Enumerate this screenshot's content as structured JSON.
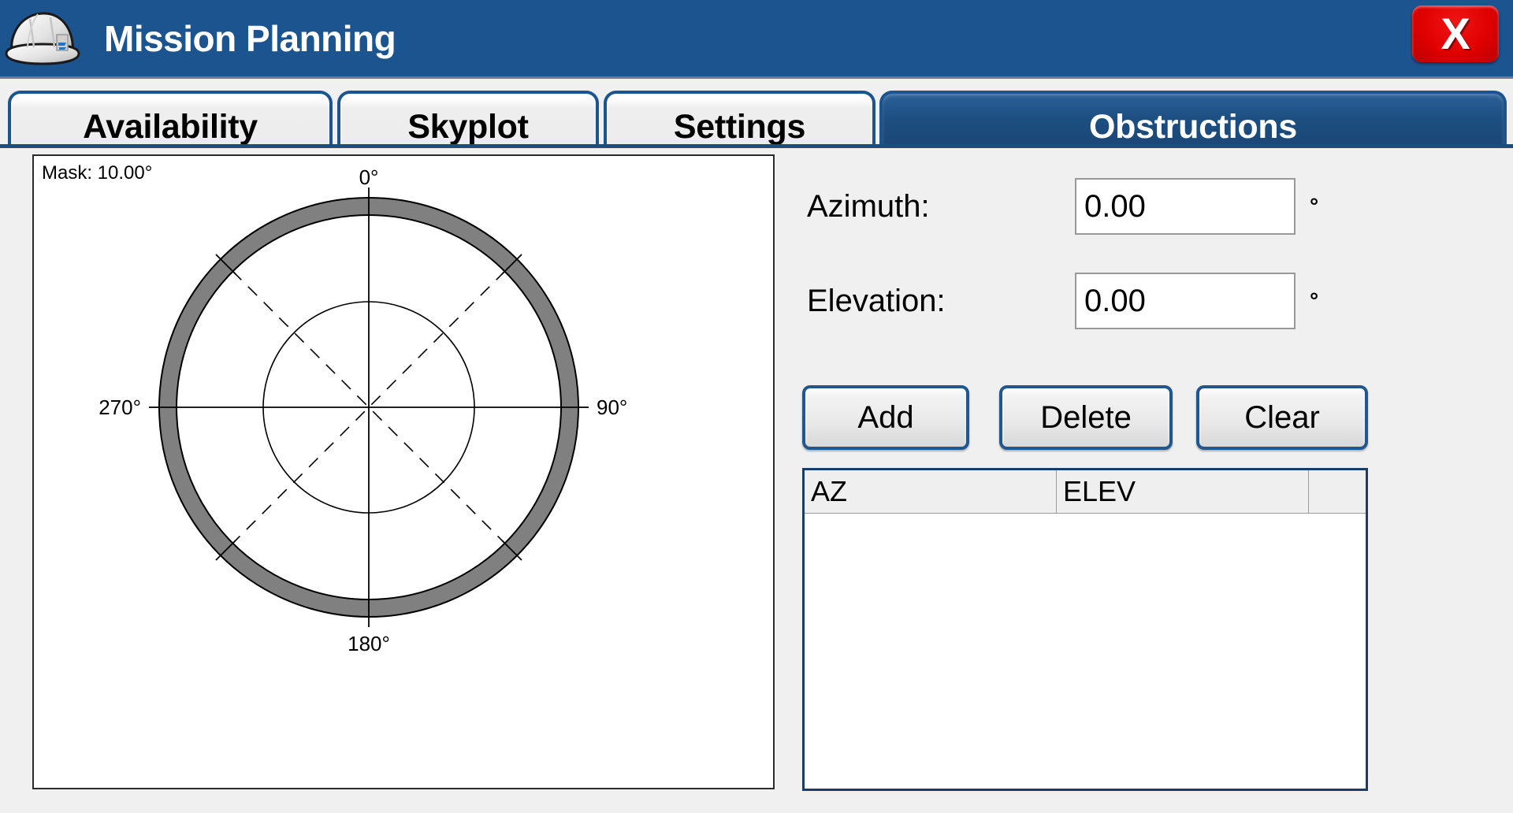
{
  "window": {
    "title": "Mission Planning",
    "icon": "hard-hat-icon",
    "close_label": "X",
    "titlebar_color": "#1c5490",
    "close_color": "#e00000"
  },
  "tabs": [
    {
      "label": "Availability",
      "active": false
    },
    {
      "label": "Skyplot",
      "active": false
    },
    {
      "label": "Settings",
      "active": false
    },
    {
      "label": "Obstructions",
      "active": true
    }
  ],
  "plot": {
    "mask_label": "Mask: 10.00°",
    "mask_value": "10.00",
    "axis_labels": {
      "north": "0°",
      "east": "90°",
      "south": "180°",
      "west": "270°"
    },
    "mask_band_color": "#808080",
    "line_color": "#000000",
    "background": "#ffffff"
  },
  "chart_data": {
    "type": "scatter",
    "title": "Obstruction Skyplot",
    "projection": "polar",
    "azimuth_ticks": [
      0,
      90,
      180,
      270
    ],
    "azimuth_tick_labels": [
      "0°",
      "90°",
      "180°",
      "270°"
    ],
    "elevation_rings": [
      0,
      45,
      90
    ],
    "mask_elevation_deg": 10.0,
    "mask_band_outer_elev_deg": 0,
    "mask_band_inner_elev_deg": 10,
    "diagonal_gridlines_deg": [
      45,
      135,
      225,
      315
    ],
    "grid": true,
    "legend": null,
    "points": []
  },
  "form": {
    "azimuth": {
      "label": "Azimuth:",
      "value": "0.00",
      "unit": "°",
      "placeholder": "0.00"
    },
    "elevation": {
      "label": "Elevation:",
      "value": "0.00",
      "unit": "°",
      "placeholder": "0.00"
    }
  },
  "buttons": {
    "add": "Add",
    "delete": "Delete",
    "clear": "Clear"
  },
  "table": {
    "columns": [
      "AZ",
      "ELEV",
      ""
    ],
    "rows": []
  }
}
